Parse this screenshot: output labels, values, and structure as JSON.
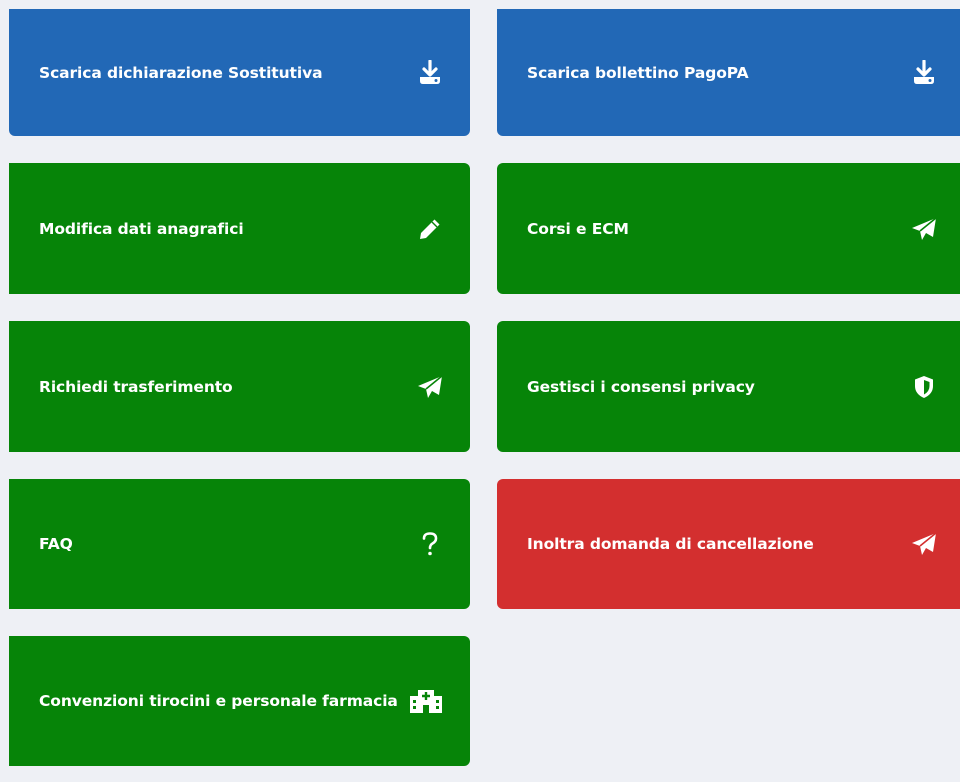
{
  "colors": {
    "blue": "#2268b6",
    "green": "#068408",
    "red": "#d32f2f",
    "background": "#eef0f5"
  },
  "tiles": [
    {
      "label": "Scarica dichiarazione Sostitutiva",
      "icon": "download-icon",
      "color": "blue"
    },
    {
      "label": "Scarica bollettino PagoPA",
      "icon": "download-icon",
      "color": "blue"
    },
    {
      "label": "Modifica dati anagrafici",
      "icon": "pencil-icon",
      "color": "green"
    },
    {
      "label": "Corsi e ECM",
      "icon": "paper-plane-icon",
      "color": "green"
    },
    {
      "label": "Richiedi trasferimento",
      "icon": "paper-plane-icon",
      "color": "green"
    },
    {
      "label": "Gestisci i consensi privacy",
      "icon": "shield-icon",
      "color": "green"
    },
    {
      "label": "FAQ",
      "icon": "question-icon",
      "color": "green"
    },
    {
      "label": "Inoltra domanda di cancellazione",
      "icon": "paper-plane-icon",
      "color": "red"
    },
    {
      "label": "Convenzioni tirocini e personale farmacia",
      "icon": "hospital-icon",
      "color": "green"
    }
  ]
}
